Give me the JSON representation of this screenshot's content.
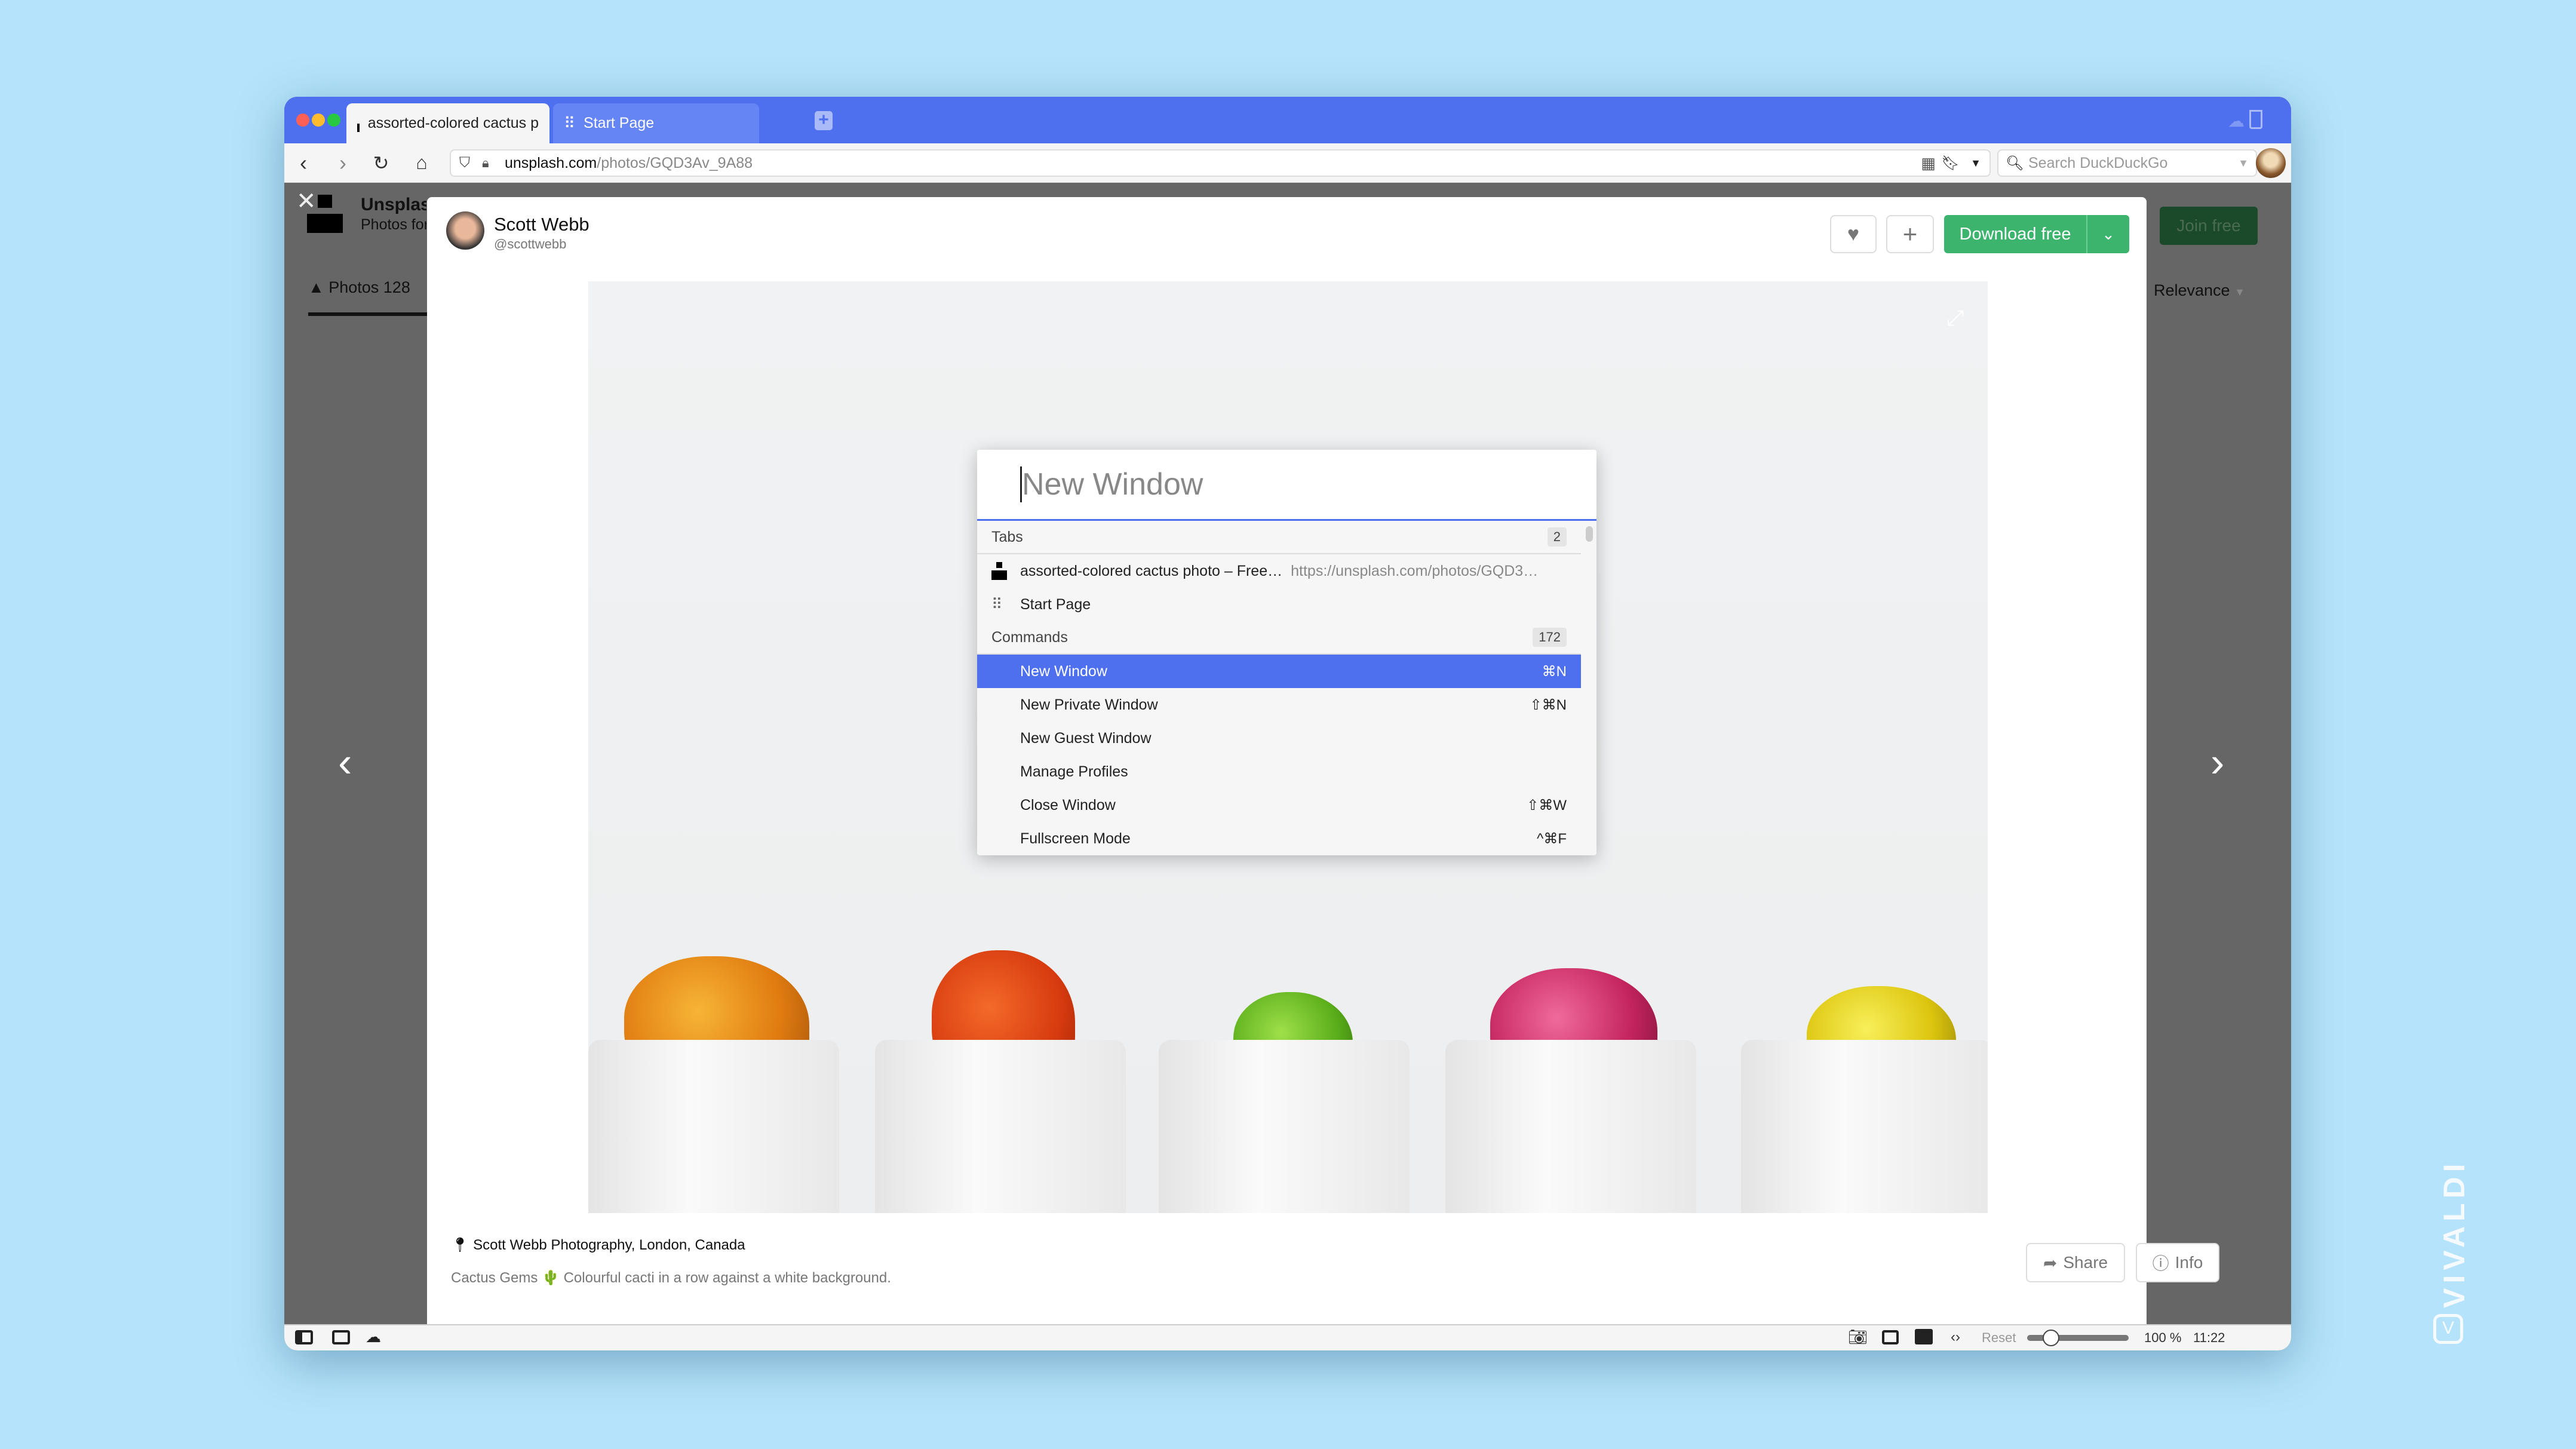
{
  "browser": {
    "tabs": [
      {
        "label": "assorted-colored cactus p",
        "active": true
      },
      {
        "label": "Start Page",
        "active": false
      }
    ],
    "url_host": "unsplash.com",
    "url_path": "/photos/GQD3Av_9A88",
    "search_placeholder": "Search DuckDuckGo",
    "accent": "#4e70ef"
  },
  "page": {
    "brand": "Unsplash",
    "brand_sub": "Photos for everyone",
    "photos_tab": "Photos 128",
    "sort": "Relevance",
    "join": "Join free",
    "author": "Scott Webb",
    "handle": "@scottwebb",
    "download": "Download free",
    "location": "Scott Webb Photography, London, Canada",
    "description": "Cactus Gems 🌵 Colourful cacti in a row against a white background.",
    "share": "Share",
    "info": "Info",
    "download_color": "#3cb46e"
  },
  "quick_commands": {
    "input": "New Window",
    "tabs_header": "Tabs",
    "tabs_count": "2",
    "tab_results": [
      {
        "title": "assorted-colored cactus photo – Free…",
        "url": "https://unsplash.com/photos/GQD3…"
      },
      {
        "title": "Start Page",
        "url": ""
      }
    ],
    "commands_header": "Commands",
    "commands_count": "172",
    "commands": [
      {
        "label": "New Window",
        "shortcut": "⌘N",
        "selected": true
      },
      {
        "label": "New Private Window",
        "shortcut": "⇧⌘N"
      },
      {
        "label": "New Guest Window",
        "shortcut": ""
      },
      {
        "label": "Manage Profiles",
        "shortcut": ""
      },
      {
        "label": "Close Window",
        "shortcut": "⇧⌘W"
      },
      {
        "label": "Fullscreen Mode",
        "shortcut": "^⌘F"
      }
    ]
  },
  "statusbar": {
    "reset": "Reset",
    "zoom": "100 %",
    "zoom_level": 100,
    "clock": "11:22"
  },
  "watermark": "VIVALDI"
}
